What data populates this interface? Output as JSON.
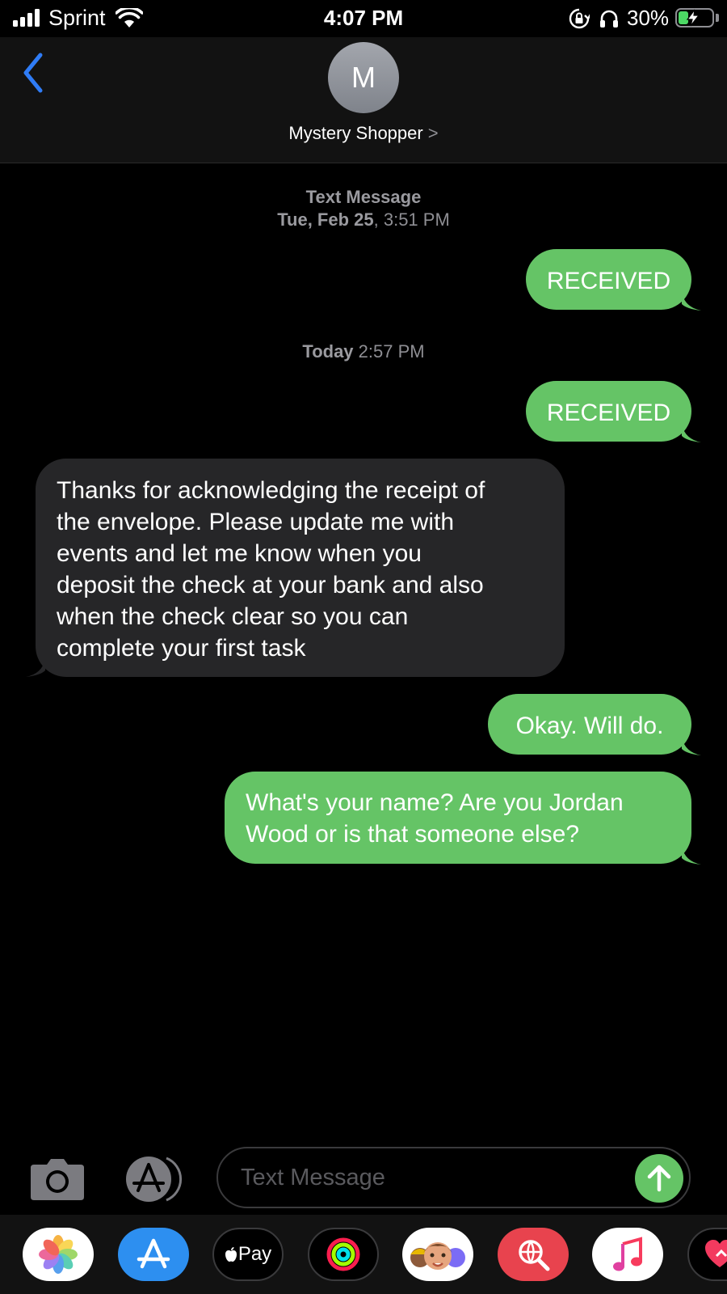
{
  "status_bar": {
    "carrier": "Sprint",
    "time": "4:07 PM",
    "battery_percent": "30%",
    "battery_level": 0.3
  },
  "header": {
    "avatar_initial": "M",
    "contact_name": "Mystery Shopper",
    "chevron": ">"
  },
  "thread": {
    "timestamp1": {
      "label": "Text Message",
      "date": "Tue, Feb 25",
      "time": ", 3:51 PM"
    },
    "timestamp2": {
      "day": "Today",
      "time": " 2:57 PM"
    },
    "messages": [
      {
        "direction": "out",
        "lines": [
          "RECEIVED"
        ]
      },
      {
        "direction": "out",
        "lines": [
          "RECEIVED"
        ]
      },
      {
        "direction": "in",
        "lines": [
          "Thanks for acknowledging the receipt of",
          "the envelope. Please update me with",
          "events and let me know when you",
          "deposit the check at your bank and also",
          "when the check clear so you can",
          "complete your first task"
        ]
      },
      {
        "direction": "out",
        "lines": [
          "Okay. Will do."
        ]
      },
      {
        "direction": "out",
        "lines": [
          "What's your name? Are you Jordan",
          "Wood or is that someone else?"
        ]
      }
    ]
  },
  "input": {
    "placeholder": "Text Message"
  },
  "app_drawer": {
    "items": [
      "photos-app-icon",
      "app-store-app-icon",
      "apple-pay-app-icon",
      "activity-app-icon",
      "memoji-app-icon",
      "web-images-app-icon",
      "music-app-icon",
      "heart-app-icon"
    ],
    "apple_pay_label": "Pay"
  },
  "colors": {
    "outgoing_bubble": "#65c466",
    "incoming_bubble": "#262628",
    "accent_blue": "#2f7cf6"
  }
}
